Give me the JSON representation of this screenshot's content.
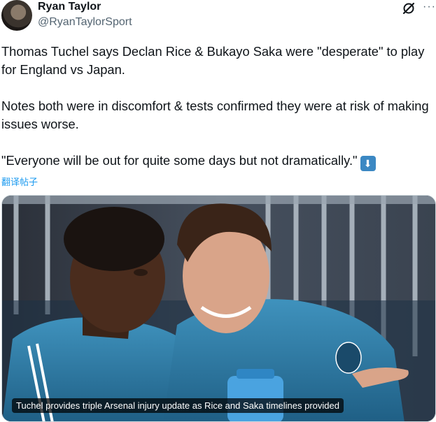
{
  "author": {
    "name": "Ryan Taylor",
    "handle": "@RyanTaylorSport"
  },
  "tweet": {
    "paragraphs": [
      "Thomas Tuchel says Declan Rice & Bukayo Saka were \"desperate\" to play for England vs Japan.",
      "Notes both were in discomfort & tests confirmed they were at risk of making issues worse.",
      "\"Everyone will be out for quite some days but not dramatically.\""
    ],
    "emoji_icon": "down-arrow-emoji",
    "translate_label": "翻译帖子"
  },
  "icons": {
    "grok": "grok-icon",
    "more": "more-icon"
  },
  "media": {
    "caption": "Tuchel provides triple Arsenal injury update as Rice and Saka timelines provided"
  },
  "colors": {
    "link": "#1d9bf0",
    "secondary_text": "#536471",
    "arsenal_jacket": "#2f7fa8"
  }
}
